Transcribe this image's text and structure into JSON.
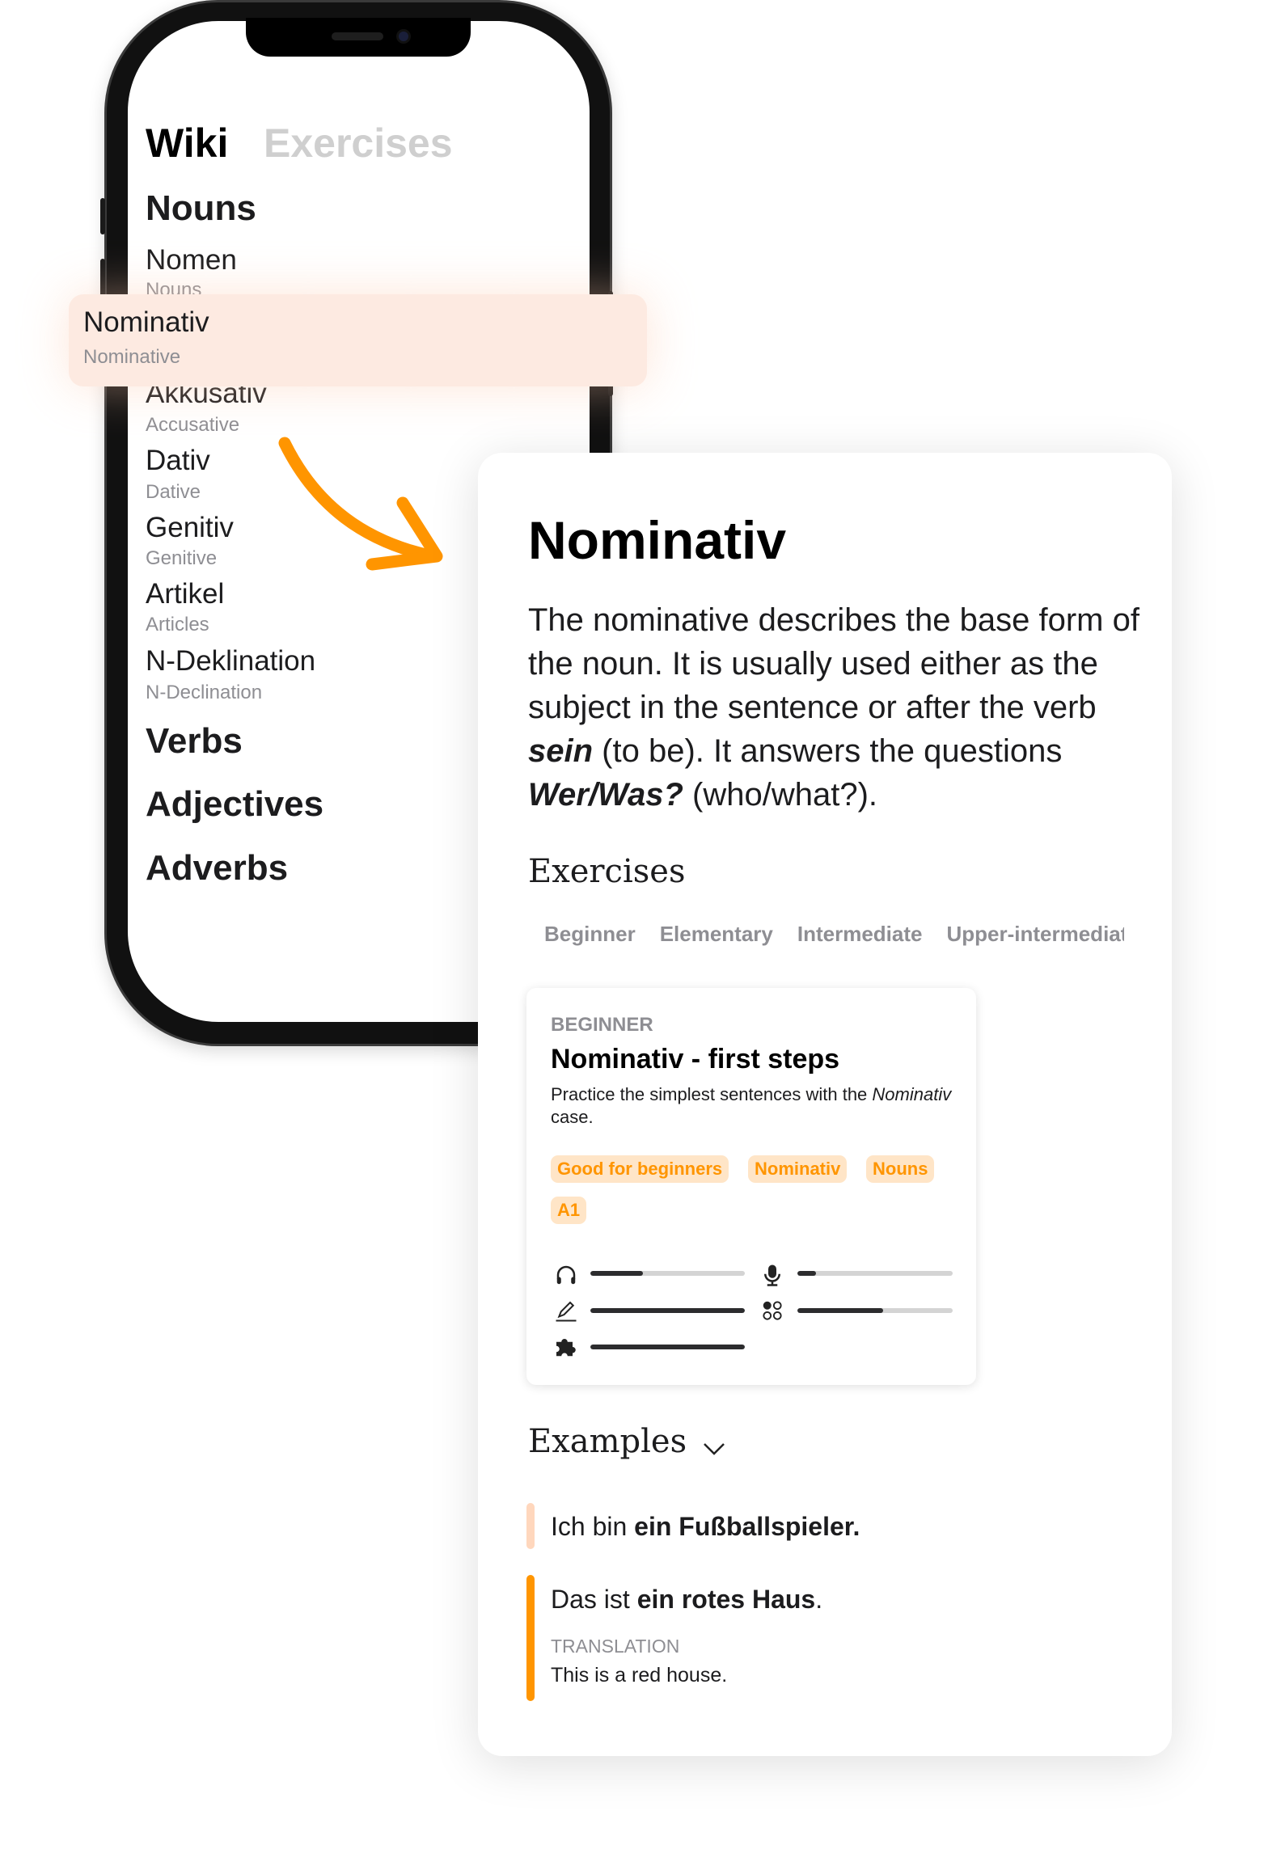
{
  "phone": {
    "tabs": [
      {
        "label": "Wiki",
        "active": true
      },
      {
        "label": "Exercises",
        "active": false
      }
    ],
    "sections": [
      "Nouns",
      "Verbs",
      "Adjectives",
      "Adverbs"
    ],
    "noun_items": [
      {
        "title": "Nomen",
        "subtitle": "Nouns"
      },
      {
        "title": "Nominativ",
        "subtitle": "Nominative",
        "selected": true
      },
      {
        "title": "Akkusativ",
        "subtitle": "Accusative"
      },
      {
        "title": "Dativ",
        "subtitle": "Dative"
      },
      {
        "title": "Genitiv",
        "subtitle": "Genitive"
      },
      {
        "title": "Artikel",
        "subtitle": "Articles"
      },
      {
        "title": "N-Deklination",
        "subtitle": "N-Declination"
      }
    ]
  },
  "detail": {
    "title": "Nominativ",
    "description": {
      "p1": "The nominative describes the base form of the noun. It is usually used either as the subject in the sentence or after the verb ",
      "b1": "sein",
      "p2": " (to be). It answers the questions ",
      "b2": "Wer/Was?",
      "p3": " (who/what?)."
    },
    "exercises_heading": "Exercises",
    "level_tabs": [
      "Beginner",
      "Elementary",
      "Intermediate",
      "Upper-intermediate"
    ],
    "exercise_card": {
      "level": "BEGINNER",
      "title": "Nominativ - first steps",
      "desc_prefix": "Practice the simplest sentences with the ",
      "desc_italic": "Nominativ",
      "desc_suffix": " case.",
      "tags": [
        "Good for beginners",
        "Nominativ",
        "Nouns",
        "A1"
      ],
      "skills": [
        {
          "icon": "headphones-icon",
          "progress": 0.34
        },
        {
          "icon": "microphone-icon",
          "progress": 0.12
        },
        {
          "icon": "pencil-icon",
          "progress": 1.0
        },
        {
          "icon": "dots-grid-icon",
          "progress": 0.55
        },
        {
          "icon": "puzzle-icon",
          "progress": 1.0
        }
      ]
    },
    "examples_heading": "Examples",
    "examples": [
      {
        "plain": "Ich bin ",
        "bold": "ein Fußballspieler.",
        "end": ""
      },
      {
        "plain": "Das ist ",
        "bold": "ein rotes Haus",
        "end": ".",
        "translation_label": "TRANSLATION",
        "translation": "This is a red house."
      }
    ],
    "accent": "#ff9500",
    "tag_bg": "#ffe5c7",
    "highlight_bg": "#fdeae1"
  }
}
